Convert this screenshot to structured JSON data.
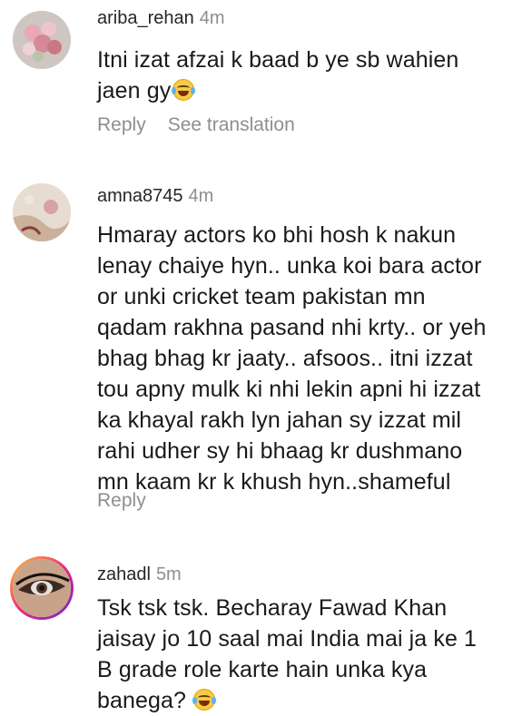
{
  "comments": [
    {
      "username": "ariba_rehan",
      "time": "4m",
      "text": "Itni izat afzai k baad b ye sb wahien\njaen gy",
      "has_emoji": true,
      "reply_label": "Reply",
      "translate_label": "See translation",
      "avatar_icon": "flowers-photo-avatar"
    },
    {
      "username": "amna8745",
      "time": "4m",
      "text": "Hmaray actors ko bhi hosh k nakun\nlenay chaiye hyn.. unka koi bara actor\nor unki cricket team pakistan mn\nqadam rakhna pasand nhi krty.. or yeh\nbhag bhag kr jaaty.. afsoos.. itni izzat\ntou apny mulk ki nhi lekin apni hi izzat\nka khayal rakh lyn jahan sy izzat mil\nrahi udher sy hi bhaag kr dushmano\nmn kaam kr k khush hyn..shameful",
      "reply_label": "Reply",
      "avatar_icon": "fabric-photo-avatar"
    },
    {
      "username": "zahadl",
      "time": "5m",
      "text": "Tsk tsk tsk. Becharay Fawad Khan\njaisay jo 10 saal mai India mai ja ke 1\nB grade role karte hain unka kya\nbanega?",
      "has_emoji": true,
      "avatar_icon": "eye-makeup-photo-avatar",
      "story_ring": true
    }
  ],
  "colors": {
    "username": "#262626",
    "secondary": "#8e8e8e",
    "story_ring": [
      "#f9ce34",
      "#ee2a7b",
      "#6228d7"
    ]
  }
}
